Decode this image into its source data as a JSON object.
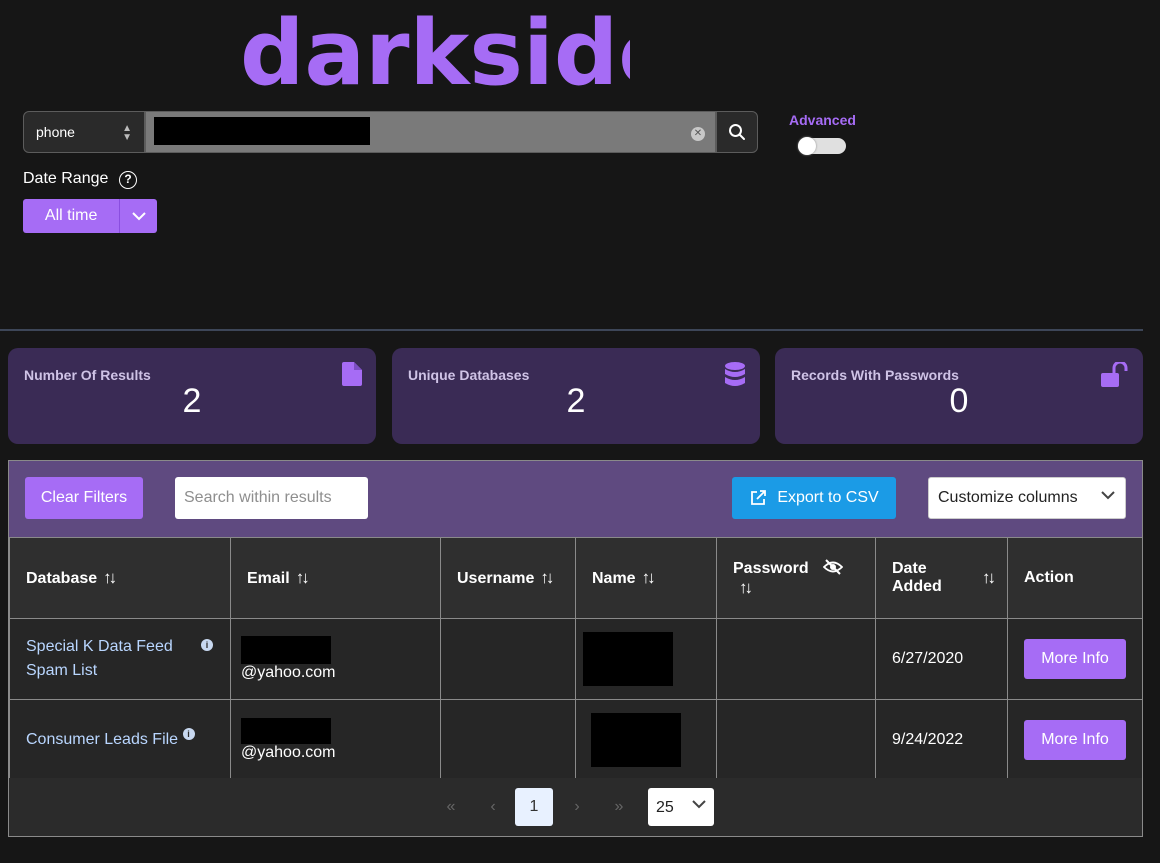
{
  "brand": {
    "logo_text": "darkside",
    "accent": "#a66cf5"
  },
  "search": {
    "field_type": "phone",
    "icon": "search-icon"
  },
  "advanced": {
    "label": "Advanced",
    "enabled": false
  },
  "date_range": {
    "label": "Date Range",
    "value": "All time"
  },
  "stats": [
    {
      "label": "Number Of Results",
      "value": "2",
      "icon": "file-icon"
    },
    {
      "label": "Unique Databases",
      "value": "2",
      "icon": "database-icon"
    },
    {
      "label": "Records With Passwords",
      "value": "0",
      "icon": "unlock-icon"
    }
  ],
  "toolbar": {
    "clear_filters": "Clear Filters",
    "search_placeholder": "Search within results",
    "export": "Export to CSV",
    "customize": "Customize columns"
  },
  "table": {
    "headers": {
      "database": "Database",
      "email": "Email",
      "username": "Username",
      "name": "Name",
      "password": "Password",
      "date_added_1": "Date",
      "date_added_2": "Added",
      "action": "Action"
    },
    "rows": [
      {
        "database_1": "Special K Data Feed",
        "database_2": "Spam List",
        "email_suffix": "@yahoo.com",
        "date": "6/27/2020",
        "action": "More Info"
      },
      {
        "database_1": "Consumer Leads File",
        "email_suffix": "@yahoo.com",
        "date": "9/24/2022",
        "action": "More Info"
      }
    ]
  },
  "pagination": {
    "first": "«",
    "prev": "‹",
    "current": "1",
    "next": "›",
    "last": "»",
    "page_size": "25"
  }
}
